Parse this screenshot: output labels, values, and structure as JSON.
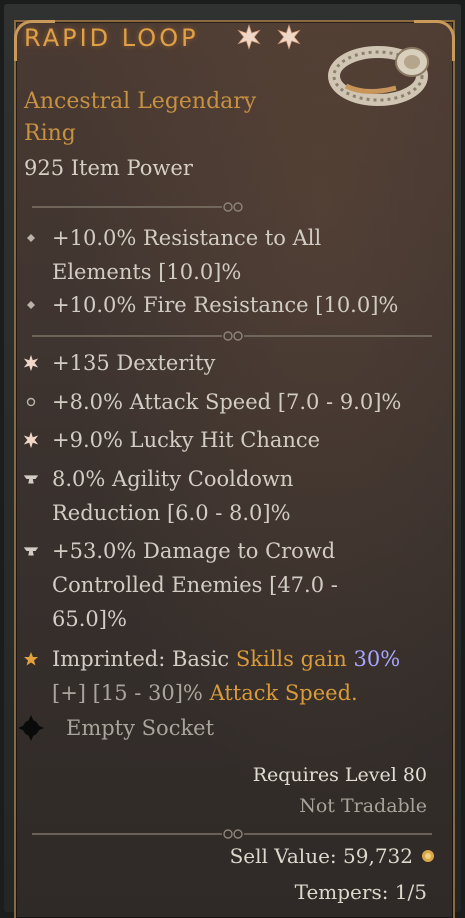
{
  "item": {
    "name": "RAPID LOOP",
    "type_line1": "Ancestral Legendary",
    "type_line2": "Ring",
    "item_power": "925 Item Power"
  },
  "implicits": [
    {
      "line1": "+10.0% Resistance to All",
      "line2": "Elements [10.0]%"
    },
    {
      "line1": "+10.0% Fire Resistance [10.0]%"
    }
  ],
  "affixes": [
    {
      "line1": "+135 Dexterity"
    },
    {
      "line1": "+8.0% Attack Speed [7.0 - 9.0]%"
    },
    {
      "line1": "+9.0% Lucky Hit Chance"
    },
    {
      "line1": "8.0% Agility Cooldown",
      "line2": "Reduction [6.0 - 8.0]%"
    },
    {
      "line1": "+53.0% Damage to Crowd",
      "line2": "Controlled Enemies [47.0 -",
      "line3": "65.0]%"
    }
  ],
  "imprint": {
    "prefix": "Imprinted: Basic ",
    "skills": "Skills gain ",
    "value": "30%",
    "range": "[+] [15 - 30]% ",
    "stat": "Attack Speed."
  },
  "socket": "Empty Socket",
  "requirements": {
    "level": "Requires Level 80",
    "tradable": "Not Tradable"
  },
  "sell_value": "Sell Value: 59,732",
  "tempers": "Tempers: 1/5",
  "colors": {
    "legendary": "#e0a048",
    "type": "#c79142",
    "highlight_blue": "#a6a6ff"
  }
}
